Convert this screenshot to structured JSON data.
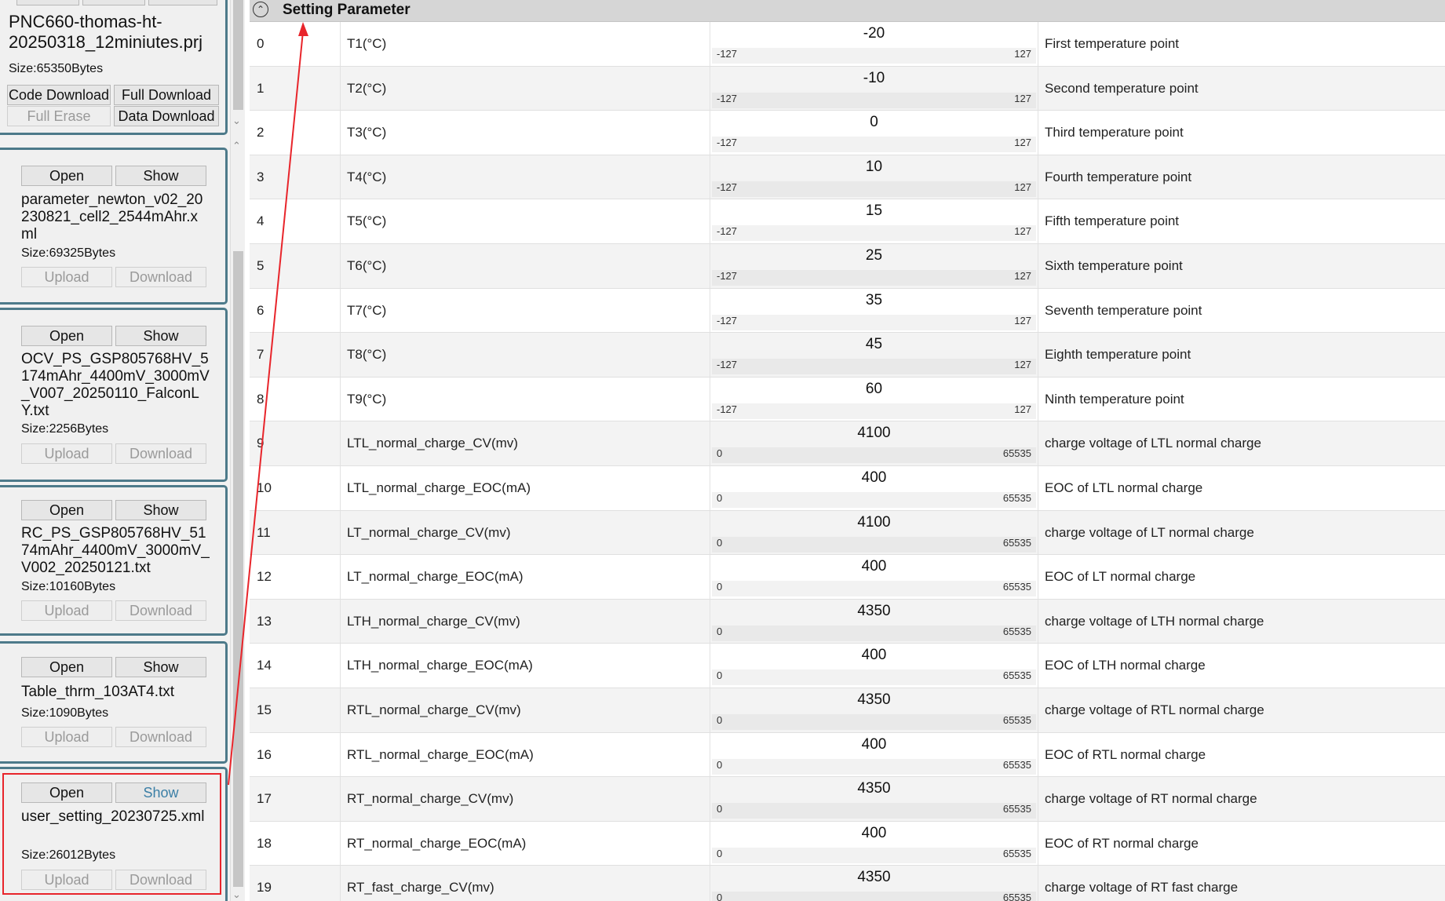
{
  "top_card": {
    "filename": "PNC660-thomas-ht-20250318_12miniutes.prj",
    "size": "Size:65350Bytes",
    "code_download": "Code Download",
    "full_download": "Full Download",
    "full_erase": "Full Erase",
    "data_download": "Data Download"
  },
  "file_cards": [
    {
      "open": "Open",
      "show": "Show",
      "filename": "parameter_newton_v02_20230821_cell2_2544mAhr.xml",
      "size": "Size:69325Bytes",
      "upload": "Upload",
      "download": "Download"
    },
    {
      "open": "Open",
      "show": "Show",
      "filename": "OCV_PS_GSP805768HV_5174mAhr_4400mV_3000mV_V007_20250110_FalconLY.txt",
      "size": "Size:2256Bytes",
      "upload": "Upload",
      "download": "Download"
    },
    {
      "open": "Open",
      "show": "Show",
      "filename": "RC_PS_GSP805768HV_5174mAhr_4400mV_3000mV_V002_20250121.txt",
      "size": "Size:10160Bytes",
      "upload": "Upload",
      "download": "Download"
    },
    {
      "open": "Open",
      "show": "Show",
      "filename": "Table_thrm_103AT4.txt",
      "size": "Size:1090Bytes",
      "upload": "Upload",
      "download": "Download"
    },
    {
      "open": "Open",
      "show": "Show",
      "filename": "user_setting_20230725.xml",
      "size": "Size:26012Bytes",
      "upload": "Upload",
      "download": "Download"
    }
  ],
  "header": {
    "title": "Setting Parameter",
    "icon": "chevron-up-circle-icon"
  },
  "annotation": {
    "color": "#e8252b"
  },
  "rows": [
    {
      "idx": "0",
      "name": "T1(°C)",
      "value": "-20",
      "min": "-127",
      "max": "127",
      "desc": "First temperature point"
    },
    {
      "idx": "1",
      "name": "T2(°C)",
      "value": "-10",
      "min": "-127",
      "max": "127",
      "desc": "Second temperature point"
    },
    {
      "idx": "2",
      "name": "T3(°C)",
      "value": "0",
      "min": "-127",
      "max": "127",
      "desc": "Third temperature point"
    },
    {
      "idx": "3",
      "name": "T4(°C)",
      "value": "10",
      "min": "-127",
      "max": "127",
      "desc": "Fourth temperature point"
    },
    {
      "idx": "4",
      "name": "T5(°C)",
      "value": "15",
      "min": "-127",
      "max": "127",
      "desc": "Fifth temperature point"
    },
    {
      "idx": "5",
      "name": "T6(°C)",
      "value": "25",
      "min": "-127",
      "max": "127",
      "desc": "Sixth temperature point"
    },
    {
      "idx": "6",
      "name": "T7(°C)",
      "value": "35",
      "min": "-127",
      "max": "127",
      "desc": "Seventh temperature point"
    },
    {
      "idx": "7",
      "name": "T8(°C)",
      "value": "45",
      "min": "-127",
      "max": "127",
      "desc": "Eighth temperature point"
    },
    {
      "idx": "8",
      "name": "T9(°C)",
      "value": "60",
      "min": "-127",
      "max": "127",
      "desc": "Ninth temperature point"
    },
    {
      "idx": "9",
      "name": "LTL_normal_charge_CV(mv)",
      "value": "4100",
      "min": "0",
      "max": "65535",
      "desc": "charge voltage of LTL normal charge"
    },
    {
      "idx": "10",
      "name": "LTL_normal_charge_EOC(mA)",
      "value": "400",
      "min": "0",
      "max": "65535",
      "desc": "EOC of LTL normal charge"
    },
    {
      "idx": "11",
      "name": "LT_normal_charge_CV(mv)",
      "value": "4100",
      "min": "0",
      "max": "65535",
      "desc": "charge voltage of LT normal charge"
    },
    {
      "idx": "12",
      "name": "LT_normal_charge_EOC(mA)",
      "value": "400",
      "min": "0",
      "max": "65535",
      "desc": "EOC of LT normal charge"
    },
    {
      "idx": "13",
      "name": "LTH_normal_charge_CV(mv)",
      "value": "4350",
      "min": "0",
      "max": "65535",
      "desc": "charge voltage of LTH normal charge"
    },
    {
      "idx": "14",
      "name": "LTH_normal_charge_EOC(mA)",
      "value": "400",
      "min": "0",
      "max": "65535",
      "desc": "EOC of LTH normal charge"
    },
    {
      "idx": "15",
      "name": "RTL_normal_charge_CV(mv)",
      "value": "4350",
      "min": "0",
      "max": "65535",
      "desc": "charge voltage of RTL normal charge"
    },
    {
      "idx": "16",
      "name": "RTL_normal_charge_EOC(mA)",
      "value": "400",
      "min": "0",
      "max": "65535",
      "desc": "EOC of RTL normal charge"
    },
    {
      "idx": "17",
      "name": "RT_normal_charge_CV(mv)",
      "value": "4350",
      "min": "0",
      "max": "65535",
      "desc": "charge voltage of RT normal charge"
    },
    {
      "idx": "18",
      "name": "RT_normal_charge_EOC(mA)",
      "value": "400",
      "min": "0",
      "max": "65535",
      "desc": "EOC of RT normal charge"
    },
    {
      "idx": "19",
      "name": "RT_fast_charge_CV(mv)",
      "value": "4350",
      "min": "0",
      "max": "65535",
      "desc": "charge voltage of RT fast charge"
    }
  ]
}
